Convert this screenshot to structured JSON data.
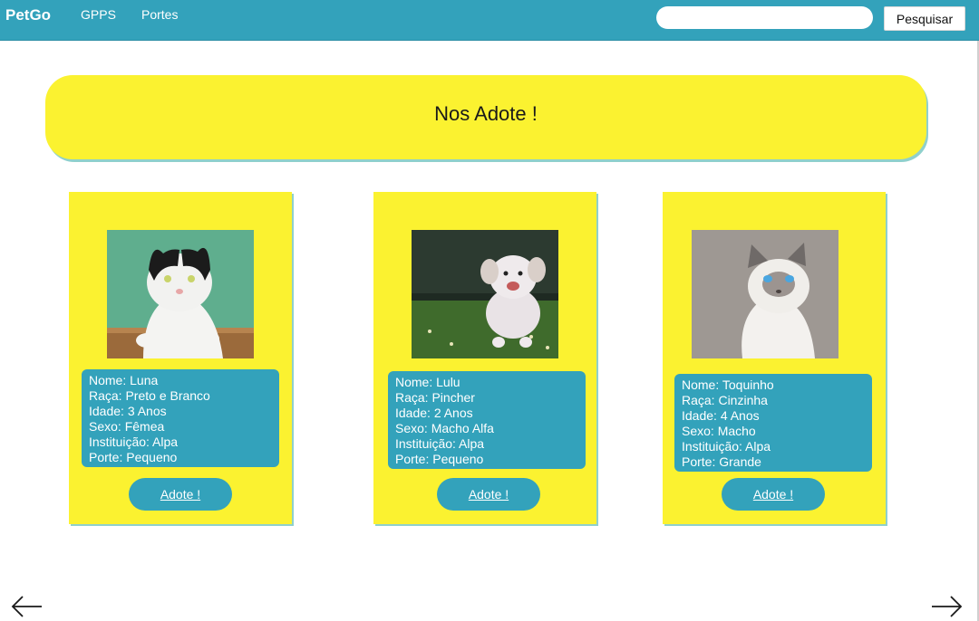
{
  "navbar": {
    "brand": "PetGo",
    "links": [
      "GPPS",
      "Portes"
    ],
    "search_placeholder": "",
    "search_button": "Pesquisar"
  },
  "banner": {
    "title": "Nos Adote !"
  },
  "cards": [
    {
      "photo": "cat-black-white-photo",
      "lines": [
        "Nome: Luna",
        "Raça: Preto e Branco",
        "Idade: 3 Anos",
        "Sexo: Fêmea",
        "Instituição: Alpa",
        "Porte: Pequeno"
      ],
      "button": "Adote !"
    },
    {
      "photo": "white-dog-running-photo",
      "lines": [
        "Nome: Lulu",
        "Raça: Pincher",
        "Idade: 2 Anos",
        "Sexo: Macho Alfa",
        "Instituição: Alpa",
        "Porte: Pequeno"
      ],
      "button": "Adote !"
    },
    {
      "photo": "siamese-cat-photo",
      "lines": [
        "Nome: Toquinho",
        "Raça: Cinzinha",
        "Idade: 4 Anos",
        "Sexo: Macho",
        "Instituição: Alpa",
        "Porte: Grande"
      ],
      "button": "Adote !"
    }
  ],
  "colors": {
    "navbar": "#33a2bb",
    "yellow": "#fbf230",
    "teal": "#33a2bb"
  },
  "icons": {
    "prev": "arrow-left-icon",
    "next": "arrow-right-icon"
  }
}
